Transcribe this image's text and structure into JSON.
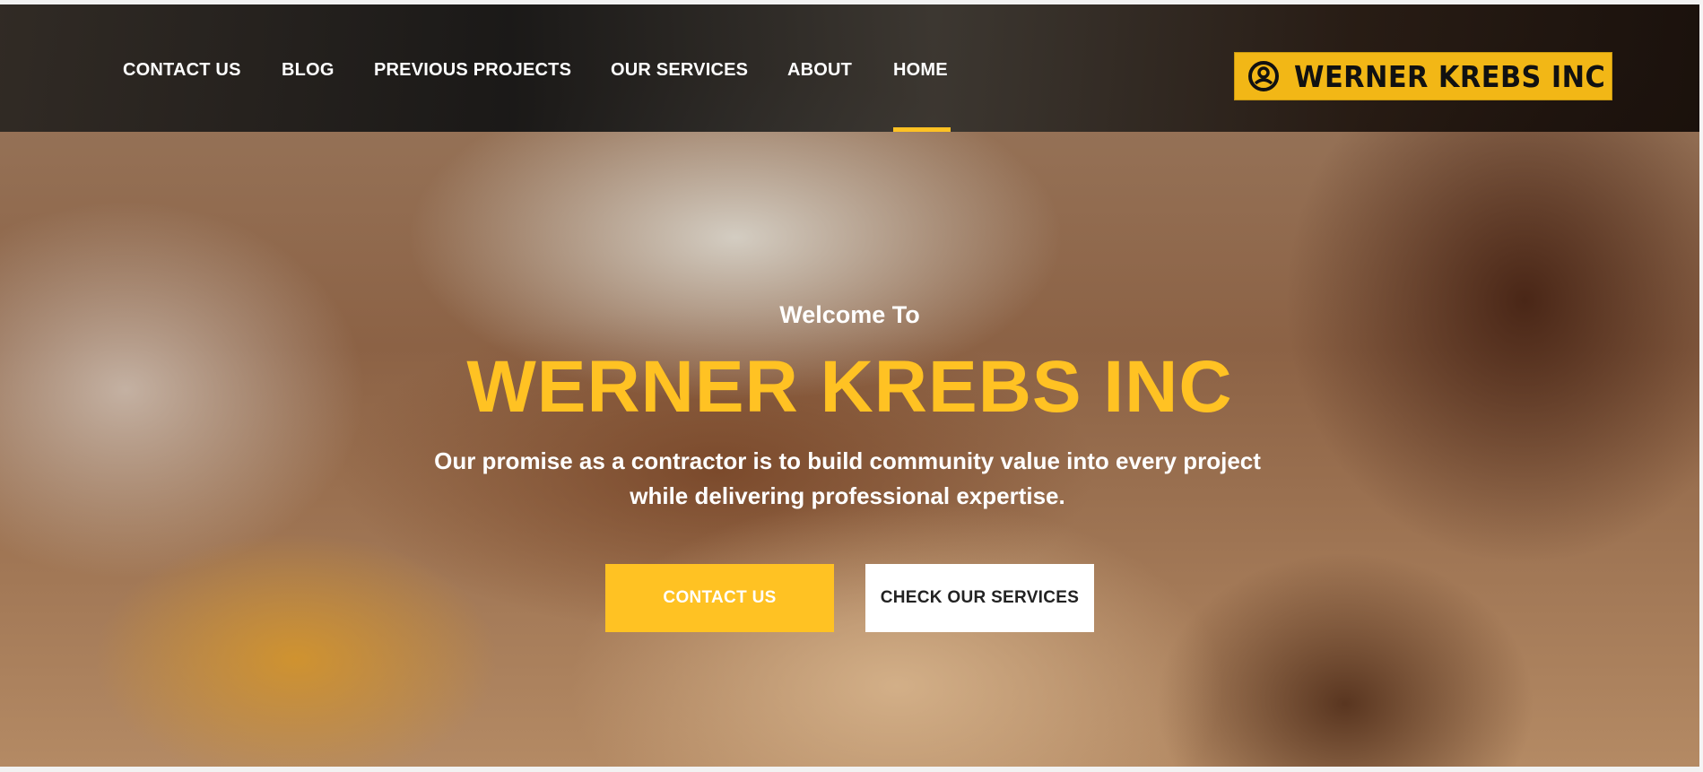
{
  "nav": {
    "items": [
      {
        "label": "CONTACT US"
      },
      {
        "label": "BLOG"
      },
      {
        "label": "PREVIOUS PROJECTS"
      },
      {
        "label": "OUR SERVICES"
      },
      {
        "label": "ABOUT"
      },
      {
        "label": "HOME"
      }
    ],
    "active": "HOME"
  },
  "logo": {
    "text": "WERNER KREBS INC",
    "icon": "circle-emblem-icon"
  },
  "hero": {
    "welcome": "Welcome To",
    "title": "WERNER KREBS INC",
    "tagline_line1": "Our promise as a contractor is to build community value into every project",
    "tagline_line2": "while delivering professional expertise.",
    "primary_button": "CONTACT US",
    "secondary_button": "CHECK OUR SERVICES"
  },
  "colors": {
    "accent": "#ffc223",
    "header_bg": "#1e1c1a",
    "button_secondary_bg": "#ffffff",
    "text_light": "#ffffff"
  }
}
